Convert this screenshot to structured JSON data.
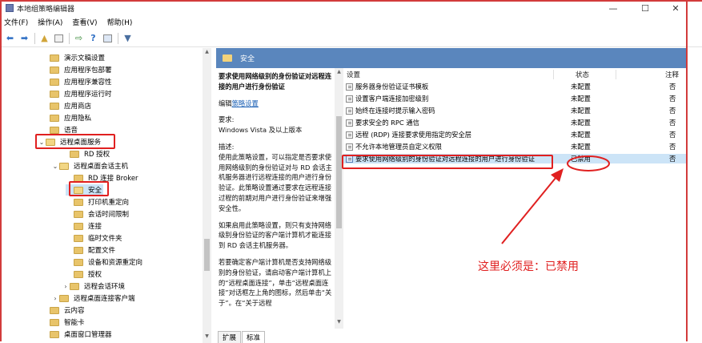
{
  "window": {
    "title": "本地组策略编辑器",
    "minimize": "—",
    "maximize": "☐",
    "close": "✕"
  },
  "menu": [
    "文件(F)",
    "操作(A)",
    "查看(V)",
    "帮助(H)"
  ],
  "tree": [
    {
      "label": "演示文稿设置"
    },
    {
      "label": "应用程序包部署"
    },
    {
      "label": "应用程序兼容性"
    },
    {
      "label": "应用程序运行时"
    },
    {
      "label": "应用商店"
    },
    {
      "label": "应用隐私"
    },
    {
      "label": "语音"
    },
    {
      "label": "远程桌面服务"
    },
    {
      "label": "RD 授权"
    },
    {
      "label": "远程桌面会话主机"
    },
    {
      "label": "RD 连接 Broker"
    },
    {
      "label": "安全"
    },
    {
      "label": "打印机重定向"
    },
    {
      "label": "会话时间限制"
    },
    {
      "label": "连接"
    },
    {
      "label": "临时文件夹"
    },
    {
      "label": "配置文件"
    },
    {
      "label": "设备和资源重定向"
    },
    {
      "label": "授权"
    },
    {
      "label": "远程会话环境"
    },
    {
      "label": "远程桌面连接客户端"
    },
    {
      "label": "云内容"
    },
    {
      "label": "智能卡"
    },
    {
      "label": "桌面窗口管理器"
    }
  ],
  "header": {
    "title": "安全"
  },
  "description": {
    "policy_title": "要求使用网络级别的身份验证对远程连接的用户进行身份验证",
    "edit_prefix": "编辑",
    "edit_link": "策略设置",
    "requirement_label": "要求:",
    "requirement_value": "Windows Vista 及以上版本",
    "desc_label": "描述:",
    "desc_p1": "使用此策略设置，可以指定是否要求使用网络级别的身份验证对与 RD 会话主机服务器进行远程连接的用户进行身份验证。此策略设置通过要求在远程连接过程的前期对用户进行身份验证来增强安全性。",
    "desc_p2": "如果启用此策略设置，则只有支持网络级别身份验证的客户端计算机才能连接到 RD 会话主机服务器。",
    "desc_p3": "若要确定客户端计算机是否支持网络级别的身份验证，请启动客户端计算机上的“远程桌面连接”，单击“远程桌面连接”对话框左上角的图标，然后单击“关于”。在“关于远程"
  },
  "list": {
    "columns": {
      "setting": "设置",
      "state": "状态",
      "note": "注释"
    },
    "rows": [
      {
        "name": "服务器身份验证证书模板",
        "state": "未配置",
        "note": "否"
      },
      {
        "name": "设置客户端连接加密级别",
        "state": "未配置",
        "note": "否"
      },
      {
        "name": "始终在连接时提示输入密码",
        "state": "未配置",
        "note": "否"
      },
      {
        "name": "要求安全的 RPC 通信",
        "state": "未配置",
        "note": "否"
      },
      {
        "name": "远程 (RDP) 连接要求使用指定的安全层",
        "state": "未配置",
        "note": "否"
      },
      {
        "name": "不允许本地管理员自定义权限",
        "state": "未配置",
        "note": "否"
      },
      {
        "name": "要求使用网络级别的身份验证对远程连接的用户进行身份验证",
        "state": "已禁用",
        "note": "否"
      }
    ]
  },
  "tabs": [
    "扩展",
    "标准"
  ],
  "annotation": "这里必须是：已禁用",
  "colors": {
    "header_bg": "#5a86bd",
    "annotation": "#e02020"
  }
}
